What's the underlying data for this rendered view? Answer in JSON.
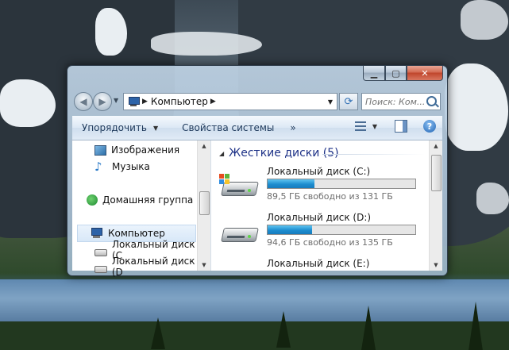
{
  "window": {
    "address": {
      "breadcrumb": "Компьютер"
    },
    "search": {
      "placeholder": "Поиск: Ком..."
    },
    "toolbar": {
      "organize_label": "Упорядочить",
      "system_properties_label": "Свойства системы",
      "more_label": "»"
    },
    "navpane": {
      "items": [
        {
          "label": "Изображения",
          "icon": "pictures-icon"
        },
        {
          "label": "Музыка",
          "icon": "music-icon"
        },
        {
          "label": "Домашняя группа",
          "icon": "homegroup-icon"
        },
        {
          "label": "Компьютер",
          "icon": "computer-icon",
          "selected": true
        },
        {
          "label": "Локальный диск (C",
          "icon": "system-drive-icon"
        },
        {
          "label": "Локальный диск (D",
          "icon": "drive-icon"
        }
      ]
    },
    "main": {
      "group_title": "Жесткие диски (5)",
      "drives": [
        {
          "name": "Локальный диск (C:)",
          "free_text": "89,5 ГБ свободно из 131 ГБ",
          "free_gb": 89.5,
          "total_gb": 131,
          "system": true
        },
        {
          "name": "Локальный диск (D:)",
          "free_text": "94,6 ГБ свободно из 135 ГБ",
          "free_gb": 94.6,
          "total_gb": 135,
          "system": false
        },
        {
          "name": "Локальный диск (E:)",
          "free_text": "",
          "system": false
        }
      ]
    }
  },
  "colors": {
    "accent": "#1e3287",
    "bar_fill": "#1e8ed0",
    "close_button": "#c0452b"
  }
}
